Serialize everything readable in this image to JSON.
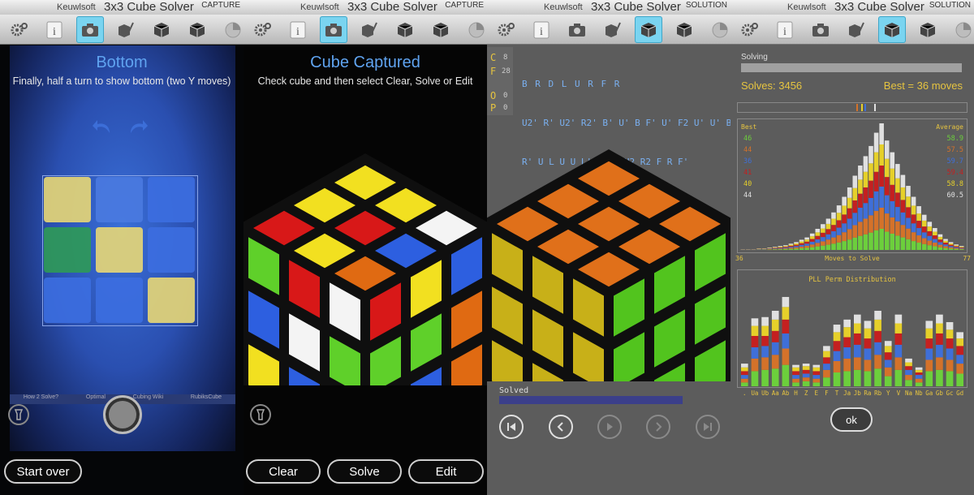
{
  "screens": [
    {
      "brand": "Keuwlsoft",
      "title": "3x3 Cube Solver",
      "mode": "CAPTURE"
    },
    {
      "brand": "Keuwlsoft",
      "title": "3x3 Cube Solver",
      "mode": "CAPTURE"
    },
    {
      "brand": "Keuwlsoft",
      "title": "3x3 Cube Solver",
      "mode": "SOLUTION"
    },
    {
      "brand": "Keuwlsoft",
      "title": "3x3 Cube Solver",
      "mode": "SOLUTION"
    }
  ],
  "toolbar_icons": [
    "gear-icon",
    "info-icon",
    "camera-icon",
    "edit-cube-icon",
    "solve-cube-icon",
    "scramble-cube-icon",
    "statistics-icon"
  ],
  "capture": {
    "heading": "Bottom",
    "instruction": "Finally, half a turn to show bottom (two Y moves)",
    "bg_links": [
      "How 2 Solve?",
      "Optimal",
      "Cubing Wiki",
      "RubiksCube"
    ],
    "start_over": "Start over",
    "face_colors": [
      "#e8d776",
      "#4a7ae0",
      "#3c6ee0",
      "#2f9a56",
      "#e8d776",
      "#3c6ee0",
      "#3c6ee0",
      "#3c6ee0",
      "#e8d776"
    ]
  },
  "captured": {
    "heading": "Cube Captured",
    "instruction": "Check cube and then select Clear, Solve or Edit",
    "clear": "Clear",
    "solve": "Solve",
    "edit": "Edit"
  },
  "solution": {
    "labels": [
      {
        "k": "C",
        "v": "8"
      },
      {
        "k": "F",
        "v": "28"
      },
      {
        "k": "O",
        "v": "0"
      },
      {
        "k": "P",
        "v": "0"
      }
    ],
    "moves_lines": [
      "B R D L U R F R",
      "U2' R' U2' R2' B' U' B F' U' F2 U' U' B'",
      "R' U L U U L' U2 R U2 R2 F R F'"
    ],
    "status": "Solved"
  },
  "stats": {
    "solving_label": "Solving",
    "solves": "Solves: 3456",
    "best": "Best = 36 moves",
    "best_header": "Best",
    "avg_header": "Average",
    "legend_best": [
      "46",
      "44",
      "36",
      "41",
      "40",
      "44"
    ],
    "legend_avg": [
      "58.9",
      "57.5",
      "59.7",
      "59.4",
      "58.8",
      "60.5"
    ],
    "legend_colors": [
      "#6ccf3c",
      "#d4722a",
      "#3f6fd8",
      "#c42020",
      "#e6d02a",
      "#e0e0e0"
    ],
    "x_min": "36",
    "x_label": "Moves to Solve",
    "x_max": "77",
    "pll_title": "PLL Perm Distribution",
    "pll_labels": [
      ".",
      "Ua",
      "Ub",
      "Aa",
      "Ab",
      "H",
      "Z",
      "E",
      "F",
      "T",
      "Ja",
      "Jb",
      "Ra",
      "Rb",
      "Y",
      "V",
      "Na",
      "Nb",
      "Ga",
      "Gb",
      "Gc",
      "Gd"
    ],
    "pll_heights": [
      [
        3,
        3,
        3,
        3,
        3,
        3
      ],
      [
        12,
        10,
        9,
        9,
        8,
        6
      ],
      [
        13,
        10,
        9,
        8,
        8,
        7
      ],
      [
        14,
        11,
        10,
        9,
        9,
        7
      ],
      [
        17,
        13,
        12,
        11,
        10,
        8
      ],
      [
        3,
        3,
        3,
        3,
        3,
        2
      ],
      [
        4,
        3,
        3,
        3,
        3,
        2
      ],
      [
        3,
        3,
        3,
        3,
        3,
        2
      ],
      [
        7,
        6,
        5,
        5,
        5,
        4
      ],
      [
        11,
        9,
        8,
        8,
        7,
        6
      ],
      [
        12,
        10,
        9,
        8,
        8,
        6
      ],
      [
        13,
        10,
        10,
        9,
        8,
        7
      ],
      [
        12,
        9,
        9,
        8,
        8,
        6
      ],
      [
        14,
        11,
        10,
        9,
        9,
        7
      ],
      [
        8,
        7,
        6,
        6,
        5,
        4
      ],
      [
        13,
        10,
        10,
        9,
        8,
        7
      ],
      [
        5,
        4,
        4,
        3,
        3,
        3
      ],
      [
        3,
        3,
        3,
        2,
        2,
        2
      ],
      [
        12,
        9,
        9,
        8,
        8,
        6
      ],
      [
        13,
        10,
        10,
        9,
        8,
        7
      ],
      [
        12,
        9,
        9,
        8,
        7,
        6
      ],
      [
        10,
        8,
        7,
        7,
        6,
        5
      ]
    ],
    "ok": "ok"
  },
  "chart_data": [
    {
      "type": "bar",
      "title": "",
      "xlabel": "Moves to Solve",
      "xlim": [
        36,
        77
      ],
      "series_colors": [
        "#6ccf3c",
        "#d4722a",
        "#3f6fd8",
        "#c42020",
        "#e6d02a",
        "#e0e0e0"
      ],
      "series_names": [
        "46",
        "44",
        "36",
        "41",
        "40",
        "44"
      ],
      "totals": [
        1,
        1,
        1,
        2,
        2,
        3,
        4,
        5,
        6,
        8,
        10,
        13,
        16,
        21,
        27,
        33,
        40,
        48,
        57,
        68,
        80,
        95,
        108,
        120,
        133,
        150,
        162,
        140,
        125,
        110,
        96,
        82,
        68,
        56,
        45,
        36,
        28,
        20,
        14,
        10,
        7,
        5
      ]
    },
    {
      "type": "bar",
      "title": "PLL Perm Distribution",
      "categories": [
        ".",
        "Ua",
        "Ub",
        "Aa",
        "Ab",
        "H",
        "Z",
        "E",
        "F",
        "T",
        "Ja",
        "Jb",
        "Ra",
        "Rb",
        "Y",
        "V",
        "Na",
        "Nb",
        "Ga",
        "Gb",
        "Gc",
        "Gd"
      ]
    }
  ]
}
